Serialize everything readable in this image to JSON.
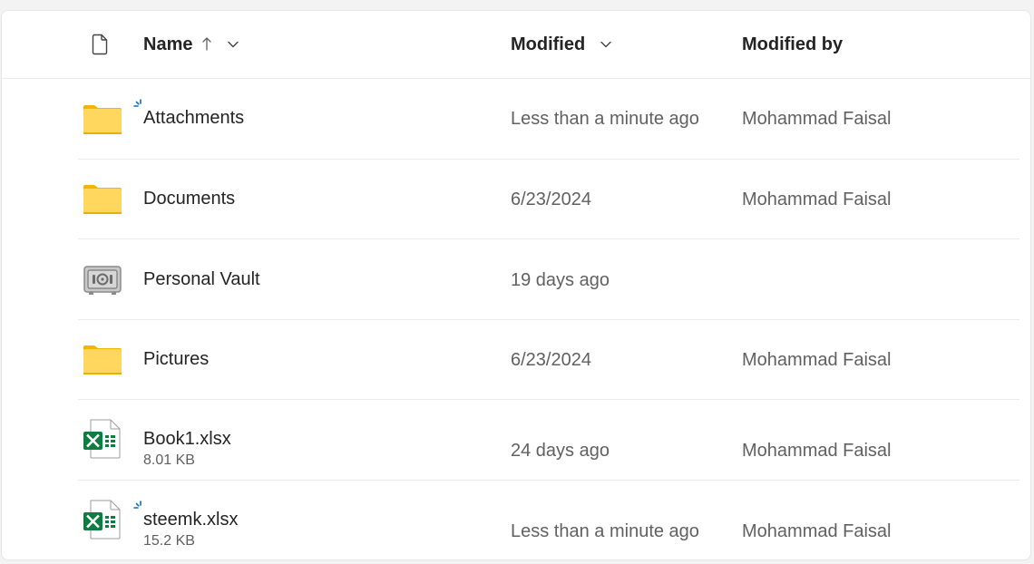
{
  "header": {
    "name_label": "Name",
    "modified_label": "Modified",
    "modified_by_label": "Modified by"
  },
  "colors": {
    "folder": "#ffd75e",
    "folder_tab": "#f4b400",
    "excel_green": "#107c41",
    "sync_blue": "#0f6cbd",
    "text_primary": "#242424",
    "text_secondary": "#616161"
  },
  "files": [
    {
      "name": "Attachments",
      "icon": "folder-icon",
      "modified": "Less than a minute ago",
      "modified_by": "Mohammad Faisal",
      "syncing": true
    },
    {
      "name": "Documents",
      "icon": "folder-icon",
      "modified": "6/23/2024",
      "modified_by": "Mohammad Faisal"
    },
    {
      "name": "Personal Vault",
      "icon": "vault-icon",
      "modified": "19 days ago",
      "modified_by": ""
    },
    {
      "name": "Pictures",
      "icon": "folder-icon",
      "modified": "6/23/2024",
      "modified_by": "Mohammad Faisal"
    },
    {
      "name": "Book1.xlsx",
      "icon": "excel-file-icon",
      "size": "8.01 KB",
      "modified": "24 days ago",
      "modified_by": "Mohammad Faisal"
    },
    {
      "name": "steemk.xlsx",
      "icon": "excel-file-icon",
      "size": "15.2 KB",
      "modified": "Less than a minute ago",
      "modified_by": "Mohammad Faisal",
      "syncing": true
    }
  ]
}
